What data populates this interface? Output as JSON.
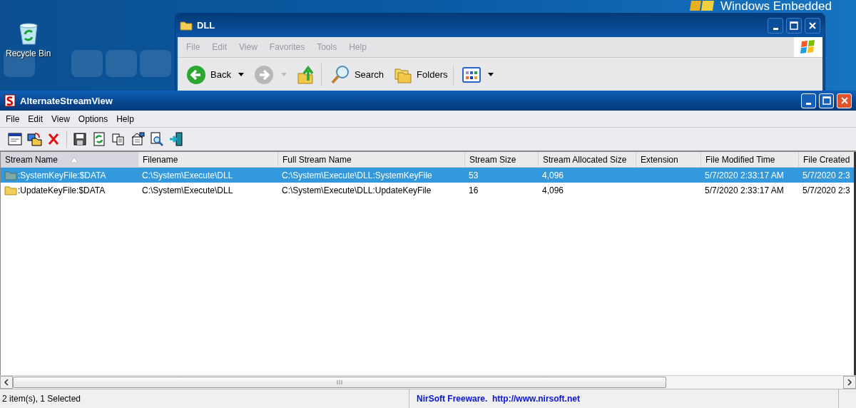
{
  "desktop": {
    "logo_text": "Windows Embedded",
    "icons": [
      {
        "label": "Recycle Bin"
      }
    ]
  },
  "explorer_window": {
    "title": "DLL",
    "active": false,
    "menu": [
      "File",
      "Edit",
      "View",
      "Favorites",
      "Tools",
      "Help"
    ],
    "toolbar": [
      {
        "kind": "back",
        "label": "Back"
      },
      {
        "kind": "forward"
      },
      {
        "kind": "up"
      },
      {
        "kind": "search",
        "label": "Search"
      },
      {
        "kind": "folders",
        "label": "Folders"
      },
      {
        "kind": "views"
      }
    ]
  },
  "app_window": {
    "title": "AlternateStreamView",
    "menu": [
      "File",
      "Edit",
      "View",
      "Options",
      "Help"
    ],
    "table": {
      "columns": [
        {
          "label": "Stream Name",
          "sorted": true
        },
        {
          "label": "Filename",
          "sorted": false
        },
        {
          "label": "Full Stream Name",
          "sorted": false
        },
        {
          "label": "Stream Size",
          "sorted": false
        },
        {
          "label": "Stream Allocated Size",
          "sorted": false
        },
        {
          "label": "Extension",
          "sorted": false
        },
        {
          "label": "File Modified Time",
          "sorted": false
        },
        {
          "label": "File Created",
          "sorted": false
        }
      ],
      "rows": [
        {
          "selected": true,
          "cells": [
            ":SystemKeyFile:$DATA",
            "C:\\System\\Execute\\DLL",
            "C:\\System\\Execute\\DLL:SystemKeyFile",
            "53",
            "4,096",
            "",
            "5/7/2020 2:33:17 AM",
            "5/7/2020 2:3"
          ]
        },
        {
          "selected": false,
          "cells": [
            ":UpdateKeyFile:$DATA",
            "C:\\System\\Execute\\DLL",
            "C:\\System\\Execute\\DLL:UpdateKeyFile",
            "16",
            "4,096",
            "",
            "5/7/2020 2:33:17 AM",
            "5/7/2020 2:3"
          ]
        }
      ]
    },
    "status_bar": {
      "count": "2 item(s), 1 Selected",
      "credit": "NirSoft Freeware.  http://www.nirsoft.net"
    }
  }
}
